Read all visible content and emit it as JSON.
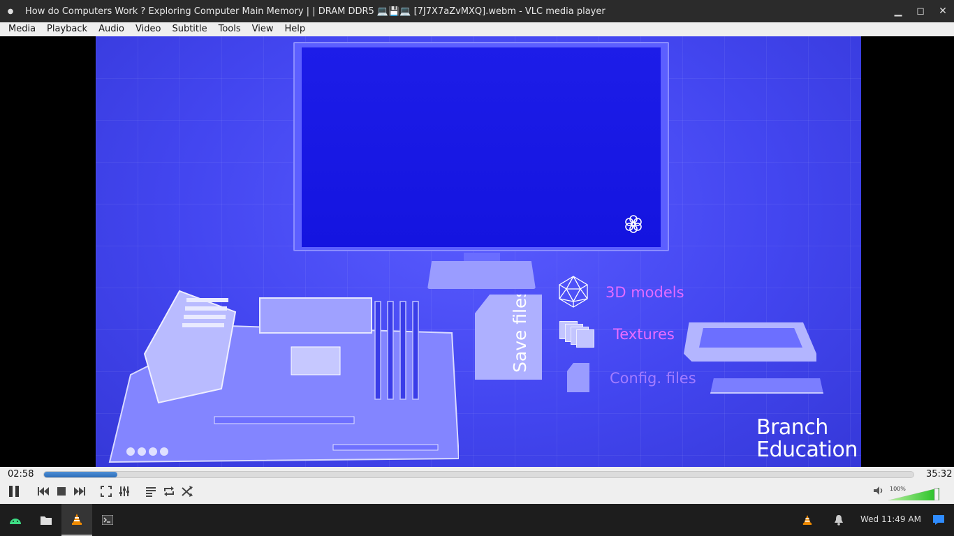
{
  "window": {
    "title": "How do Computers Work ?  Exploring Computer Main Memory  |  | DRAM DDR5 💻💾💻 [7J7X7aZvMXQ].webm - VLC media player",
    "minimize_icon": "minimize-icon",
    "maximize_icon": "maximize-icon",
    "close_icon": "close-icon"
  },
  "menu": [
    "Media",
    "Playback",
    "Audio",
    "Video",
    "Subtitle",
    "Tools",
    "View",
    "Help"
  ],
  "video": {
    "labels": {
      "models": "3D models",
      "textures": "Textures",
      "config": "Config. files",
      "save_files": "Save files"
    },
    "logo_line1": "Branch",
    "logo_line2": "Education",
    "colors": {
      "background": "#4346f0",
      "label_pink": "#e36cff"
    }
  },
  "player": {
    "elapsed": "02:58",
    "total": "35:32",
    "progress": 0.084,
    "volume_label": "100%",
    "volume": 1.0
  },
  "taskbar": {
    "clock": "Wed  11:49 AM"
  }
}
